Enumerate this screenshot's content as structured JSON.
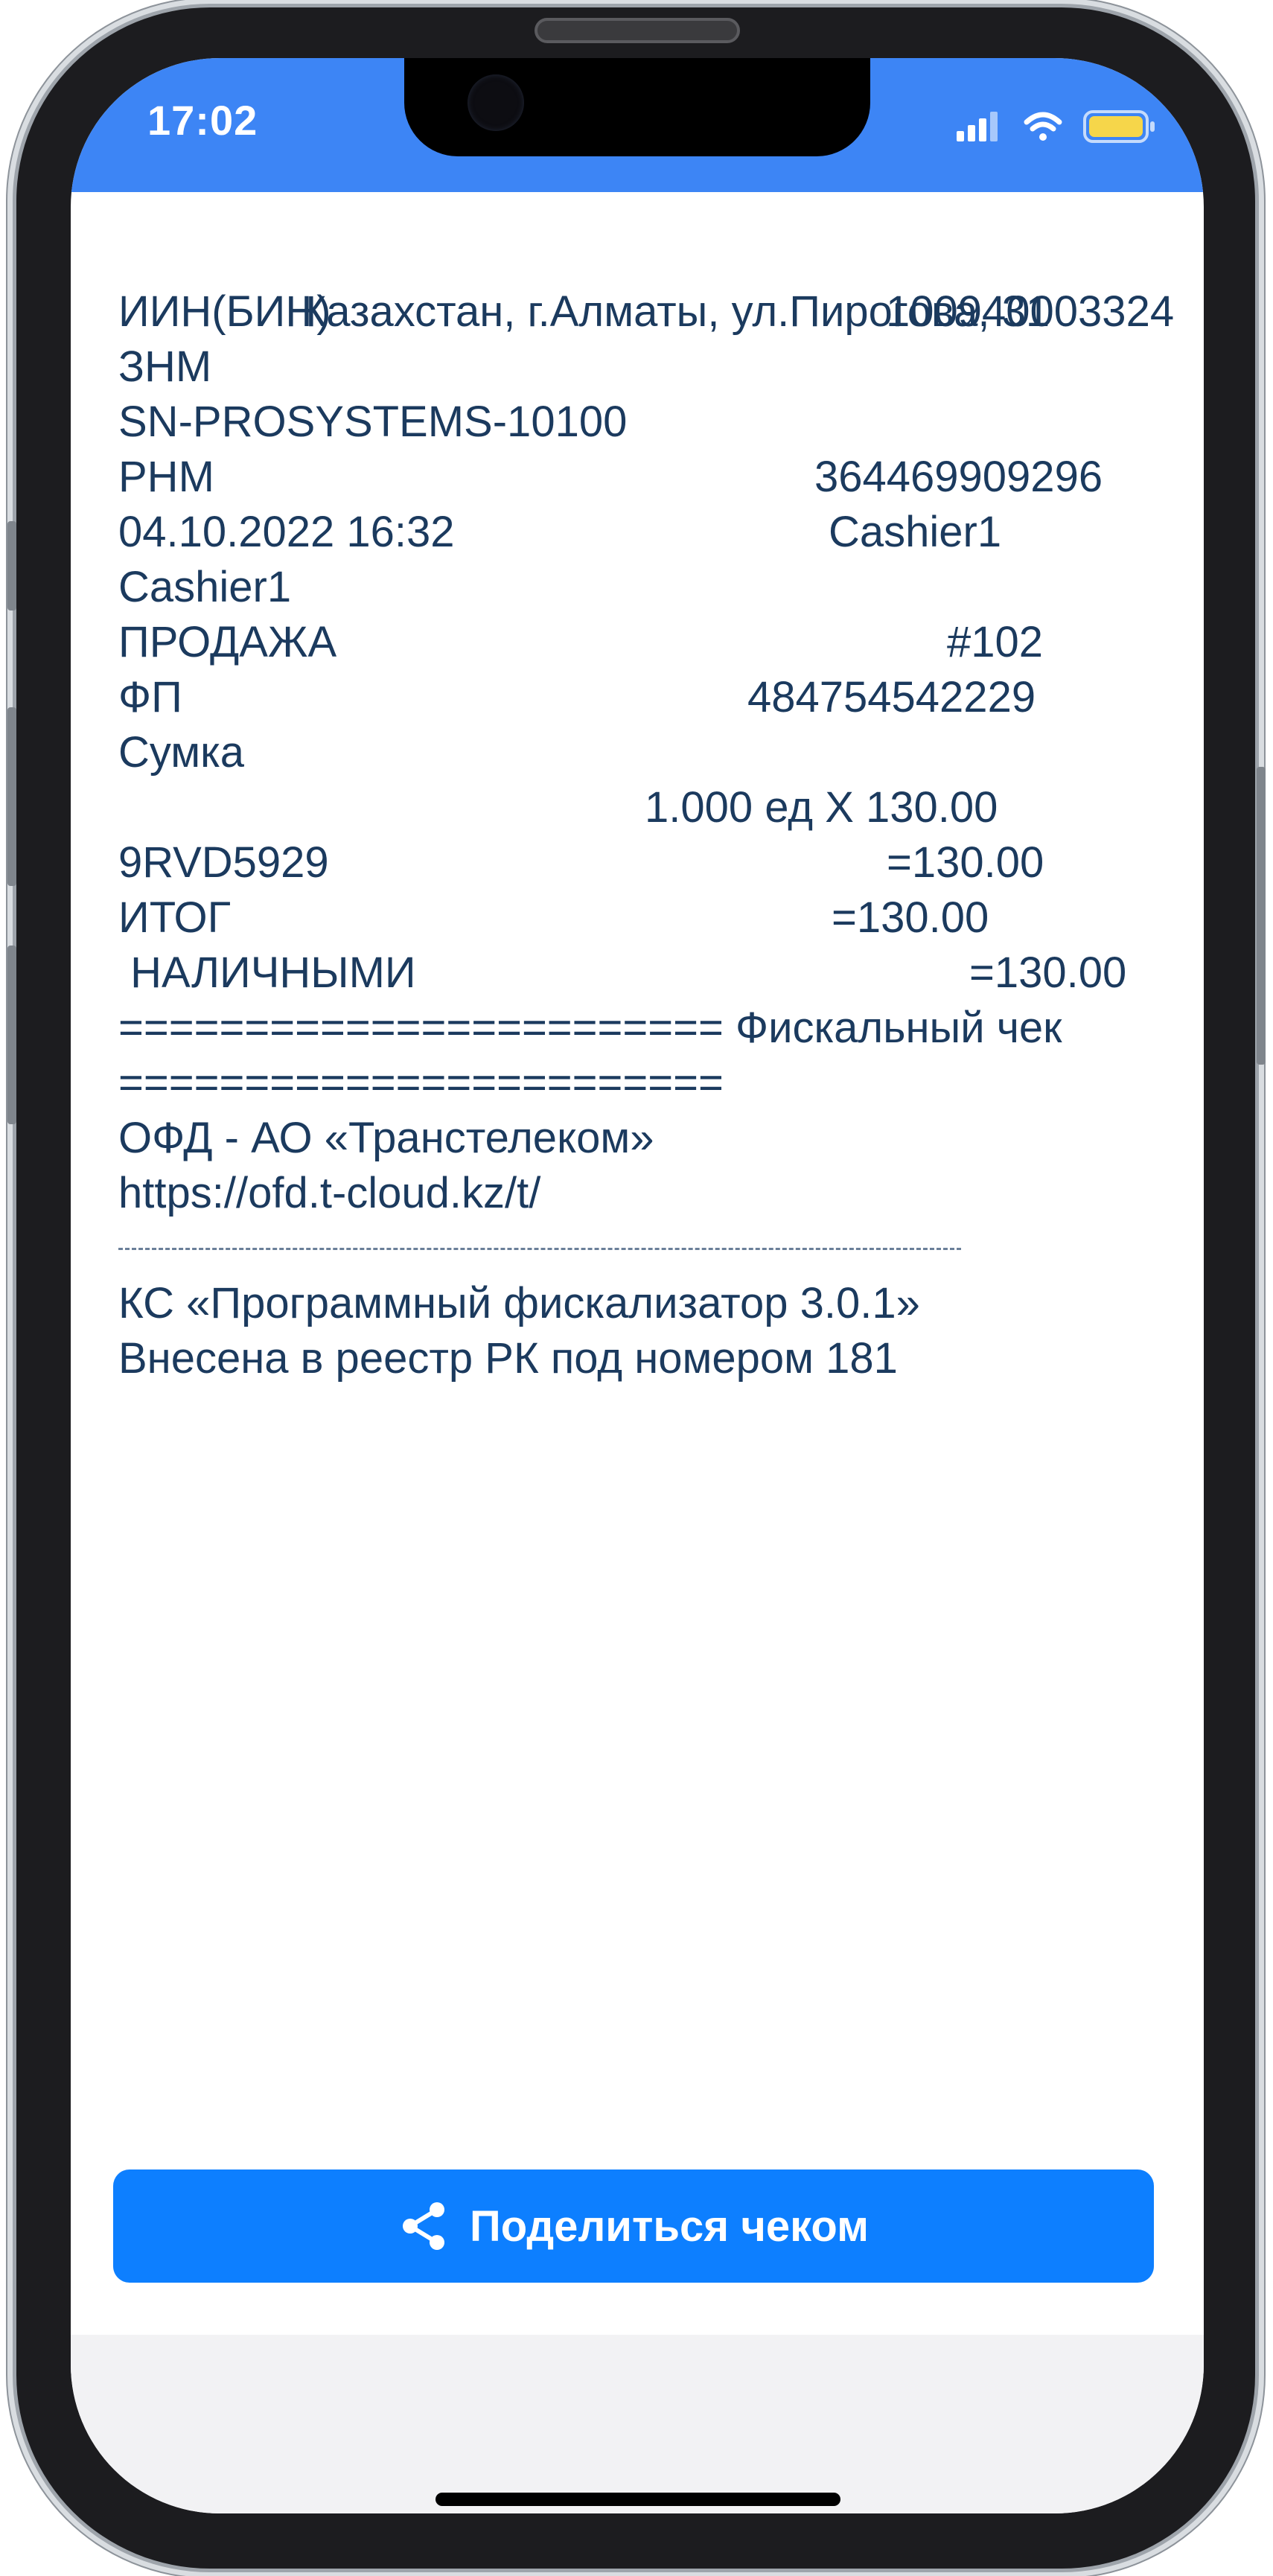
{
  "status_bar": {
    "time": "17:02",
    "icons": [
      "cellular-signal-icon",
      "wifi-icon",
      "battery-icon"
    ],
    "background_color": "#3d85f5"
  },
  "receipt": {
    "address": "Казахстан, г.Алматы, ул.Пирогова, 31",
    "rows": [
      {
        "label": "ИИН(БИН)",
        "value": "100940003324"
      },
      {
        "label": "ЗНМ",
        "value": ""
      },
      {
        "label": "SN-PROSYSTEMS-10100",
        "value": ""
      },
      {
        "label": "РНМ",
        "value": "364469909296"
      },
      {
        "label": "04.10.2022 16:32",
        "value": "Cashier1"
      },
      {
        "label": "Cashier1",
        "value": ""
      },
      {
        "label": "ПРОДАЖА",
        "value": "#102"
      },
      {
        "label": "ФП",
        "value": "484754542229"
      },
      {
        "label": "Сумка",
        "value": ""
      },
      {
        "label": "",
        "value": "1.000 ед X 130.00"
      },
      {
        "label": "9RVD5929",
        "value": "=130.00"
      },
      {
        "label": "ИТОГ",
        "value": "=130.00"
      },
      {
        "label": " НАЛИЧНЫМИ",
        "value": "=130.00"
      }
    ],
    "separator_1": "======================== Фискальный чек",
    "separator_2": "========================",
    "ofd": "ОФД - АО «Транстелеком»",
    "url": "https://ofd.t-cloud.kz/t/",
    "ks": "КС «Программный фискализатор 3.0.1»",
    "registry": "Внесена в реестр РК под номером 181",
    "text_color": "#1b3a5e"
  },
  "share_button": {
    "label": "Поделиться чеком",
    "icon": "share-icon",
    "color": "#0d7fff"
  }
}
